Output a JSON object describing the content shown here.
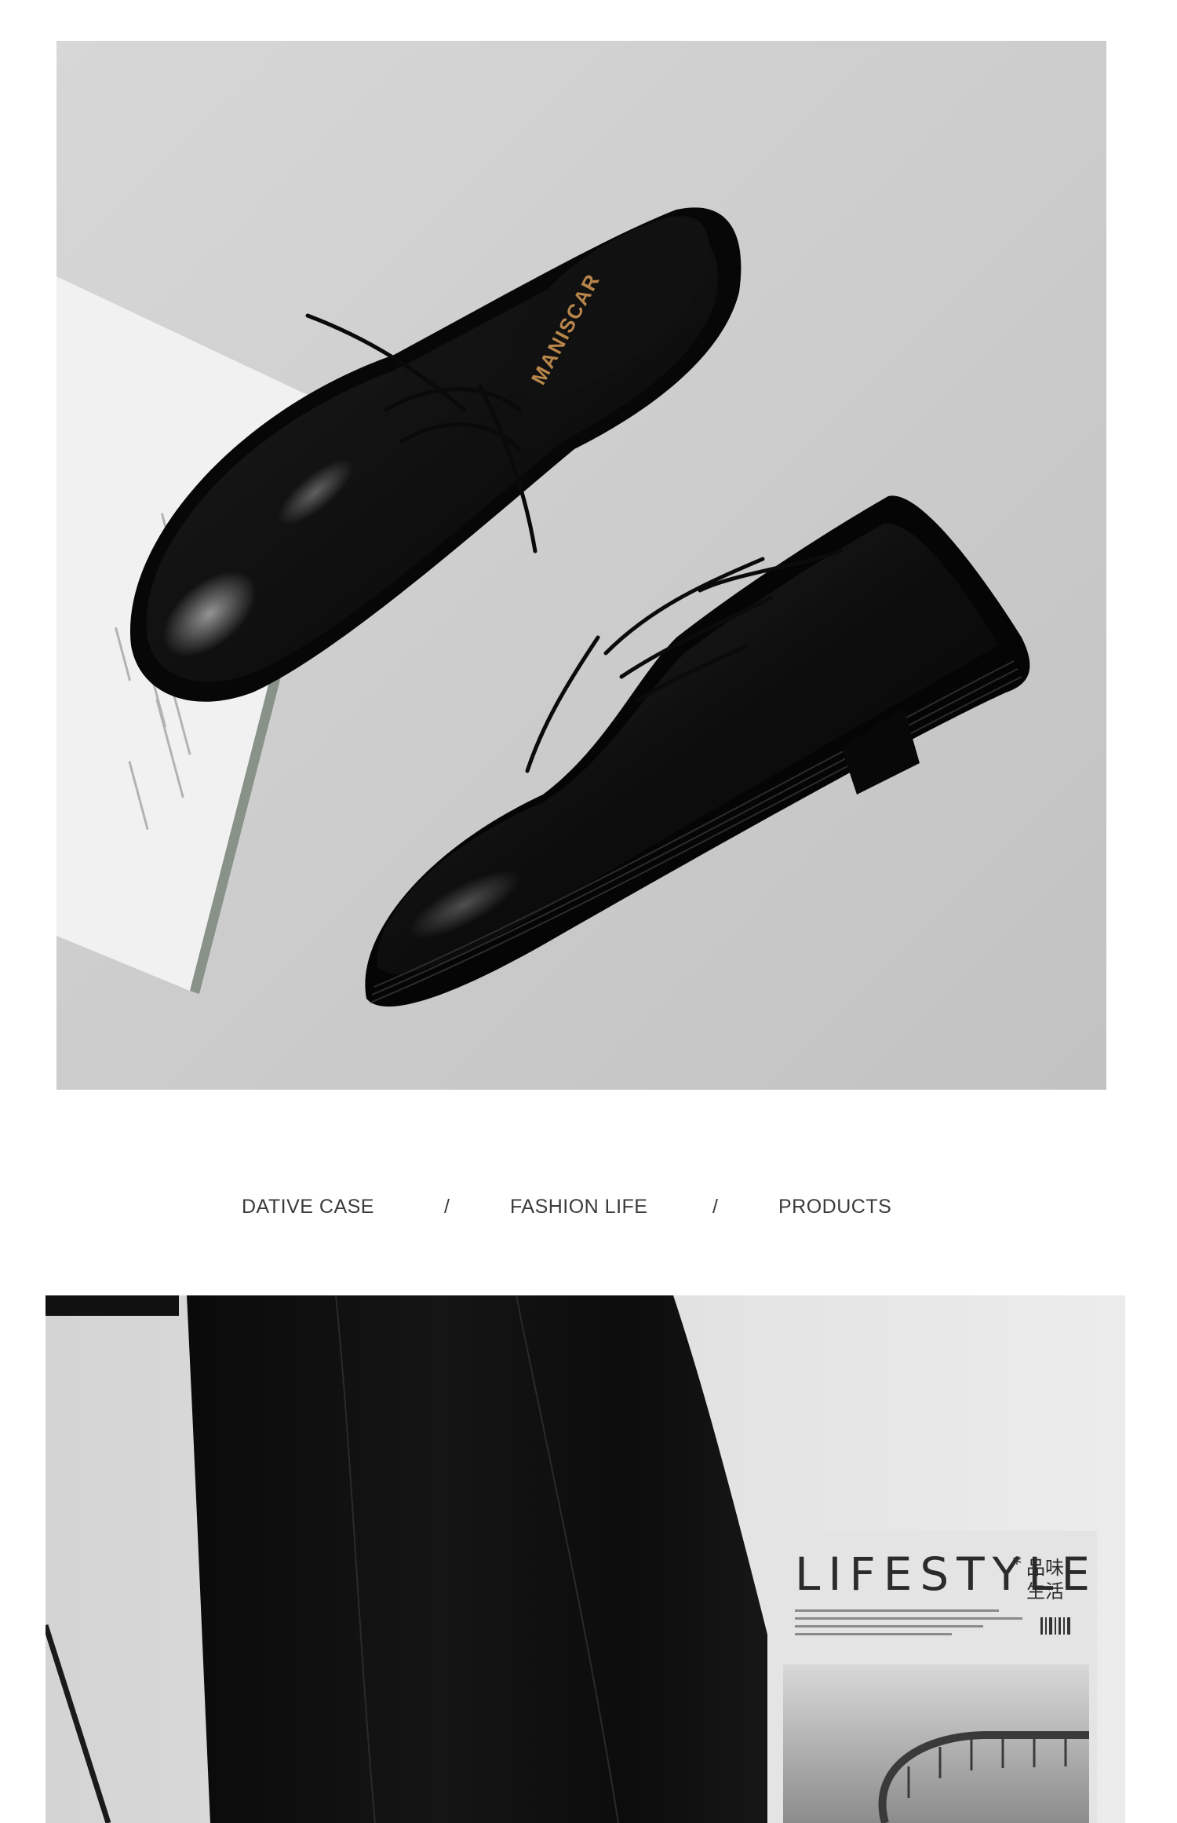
{
  "nav": {
    "items": [
      "DATIVE CASE",
      "FASHION LIFE",
      "PRODUCTS"
    ],
    "separator": "/"
  },
  "photo_top": {
    "insole_brand": "MANISCAR"
  },
  "photo_bottom": {
    "magazine_title": "LIFESTYLE",
    "magazine_asterisk": "*",
    "magazine_cjk_line1": "品味",
    "magazine_cjk_line2": "生活"
  }
}
